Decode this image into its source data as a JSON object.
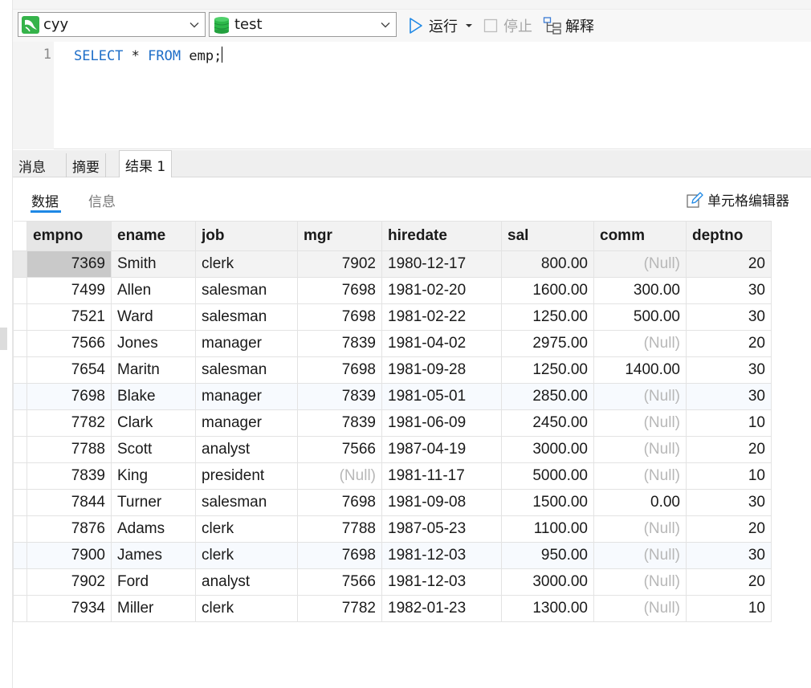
{
  "toolbar": {
    "connection": "cyy",
    "database": "test",
    "run_label": "运行",
    "stop_label": "停止",
    "explain_label": "解释"
  },
  "editor": {
    "line_number": "1",
    "keyword_select": "SELECT",
    "star": "*",
    "keyword_from": "FROM",
    "table_ref": "emp;"
  },
  "result_tabs": [
    "消息",
    "摘要",
    "结果 1"
  ],
  "sub_tabs": [
    "数据",
    "信息"
  ],
  "cell_editor_label": "单元格编辑器",
  "columns": [
    "empno",
    "ename",
    "job",
    "mgr",
    "hiredate",
    "sal",
    "comm",
    "deptno"
  ],
  "rows": [
    [
      "7369",
      "Smith",
      "clerk",
      "7902",
      "1980-12-17",
      "800.00",
      "(Null)",
      "20"
    ],
    [
      "7499",
      "Allen",
      "salesman",
      "7698",
      "1981-02-20",
      "1600.00",
      "300.00",
      "30"
    ],
    [
      "7521",
      "Ward",
      "salesman",
      "7698",
      "1981-02-22",
      "1250.00",
      "500.00",
      "30"
    ],
    [
      "7566",
      "Jones",
      "manager",
      "7839",
      "1981-04-02",
      "2975.00",
      "(Null)",
      "20"
    ],
    [
      "7654",
      "Maritn",
      "salesman",
      "7698",
      "1981-09-28",
      "1250.00",
      "1400.00",
      "30"
    ],
    [
      "7698",
      "Blake",
      "manager",
      "7839",
      "1981-05-01",
      "2850.00",
      "(Null)",
      "30"
    ],
    [
      "7782",
      "Clark",
      "manager",
      "7839",
      "1981-06-09",
      "2450.00",
      "(Null)",
      "10"
    ],
    [
      "7788",
      "Scott",
      "analyst",
      "7566",
      "1987-04-19",
      "3000.00",
      "(Null)",
      "20"
    ],
    [
      "7839",
      "King",
      "president",
      "(Null)",
      "1981-11-17",
      "5000.00",
      "(Null)",
      "10"
    ],
    [
      "7844",
      "Turner",
      "salesman",
      "7698",
      "1981-09-08",
      "1500.00",
      "0.00",
      "30"
    ],
    [
      "7876",
      "Adams",
      "clerk",
      "7788",
      "1987-05-23",
      "1100.00",
      "(Null)",
      "20"
    ],
    [
      "7900",
      "James",
      "clerk",
      "7698",
      "1981-12-03",
      "950.00",
      "(Null)",
      "30"
    ],
    [
      "7902",
      "Ford",
      "analyst",
      "7566",
      "1981-12-03",
      "3000.00",
      "(Null)",
      "20"
    ],
    [
      "7934",
      "Miller",
      "clerk",
      "7782",
      "1982-01-23",
      "1300.00",
      "(Null)",
      "10"
    ]
  ],
  "colors": {
    "accent": "#1e88e5",
    "keyword": "#1e6ec8",
    "null_text": "#b7b7b7",
    "db_icon": "#2db84a"
  },
  "icons": {
    "connection": "mysql-dolphin-icon",
    "database": "database-cylinder-icon",
    "run": "play-icon",
    "stop": "stop-checkbox-icon",
    "explain": "explain-icon",
    "cell_editor": "pencil-icon"
  }
}
